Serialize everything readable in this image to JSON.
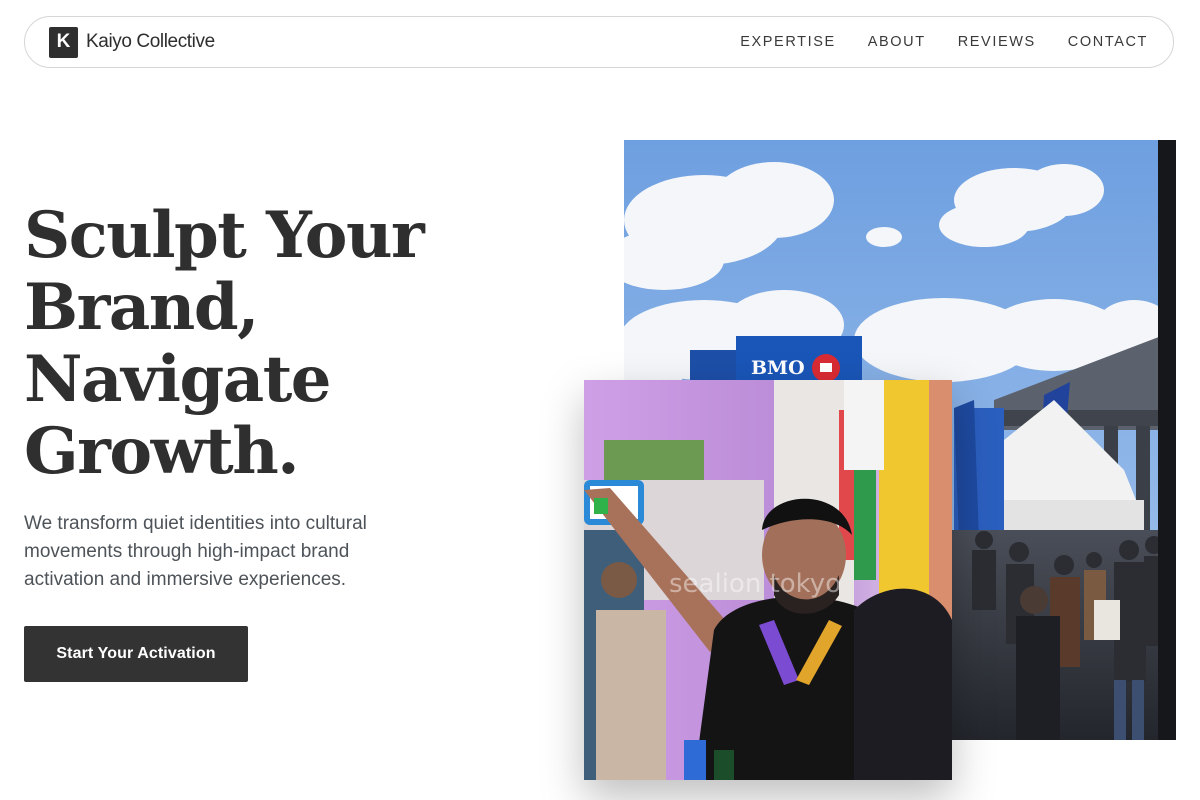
{
  "nav": {
    "logo_letter": "K",
    "brand": "Kaiyo Collective",
    "links": [
      "EXPERTISE",
      "ABOUT",
      "REVIEWS",
      "CONTACT"
    ]
  },
  "hero": {
    "headline_lines": [
      "Sculpt Your",
      "Brand,",
      "Navigate",
      "Growth."
    ],
    "subtext": "We transform quiet identities into cultural movements through high-impact brand activation and immersive experiences.",
    "cta_label": "Start Your Activation"
  },
  "photos": {
    "main_sign": "BMO",
    "inset_watermark": "sealion tokyo"
  },
  "colors": {
    "text": "#2f2f2f",
    "body_text": "#4d5358",
    "button_bg": "#333333",
    "sky": "#7ea9e0"
  }
}
